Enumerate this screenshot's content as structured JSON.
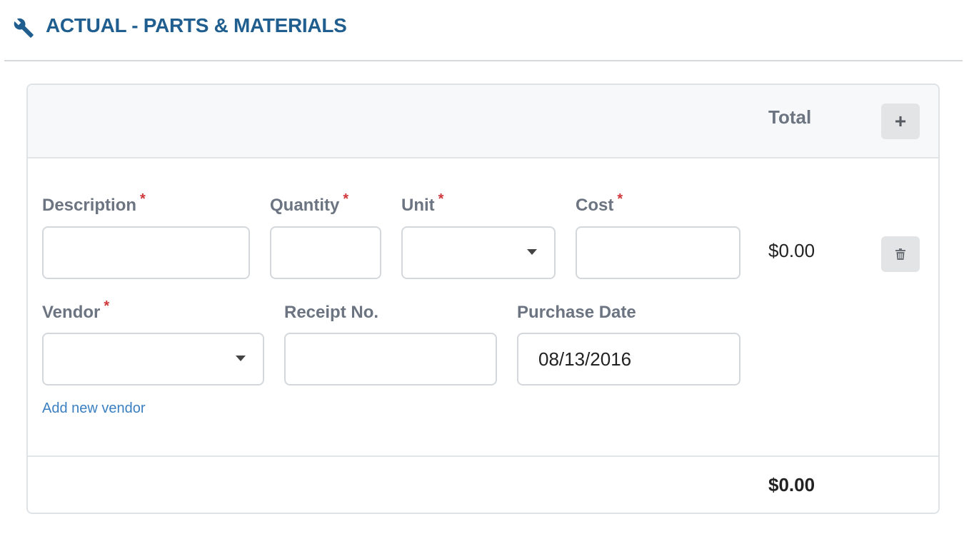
{
  "section": {
    "title": "ACTUAL - PARTS & MATERIALS",
    "icon": "wrench-icon"
  },
  "table": {
    "total_header": "Total",
    "add_button_icon": "plus-icon",
    "row": {
      "description_label": "Description",
      "description_value": "",
      "quantity_label": "Quantity",
      "quantity_value": "",
      "unit_label": "Unit",
      "unit_value": "",
      "cost_label": "Cost",
      "cost_value": "",
      "required_marker": "*",
      "row_total": "$0.00",
      "delete_button_icon": "trash-icon",
      "vendor_label": "Vendor",
      "vendor_value": "",
      "receipt_label": "Receipt No.",
      "receipt_value": "",
      "purchase_date_label": "Purchase Date",
      "purchase_date_value": "08/13/2016",
      "add_vendor_link": "Add new vendor"
    },
    "grand_total": "$0.00"
  },
  "colors": {
    "title": "#1f5e8e",
    "label": "#6b7480",
    "required": "#d0373a",
    "link": "#3a7fc1",
    "border": "#d4d8dc"
  }
}
